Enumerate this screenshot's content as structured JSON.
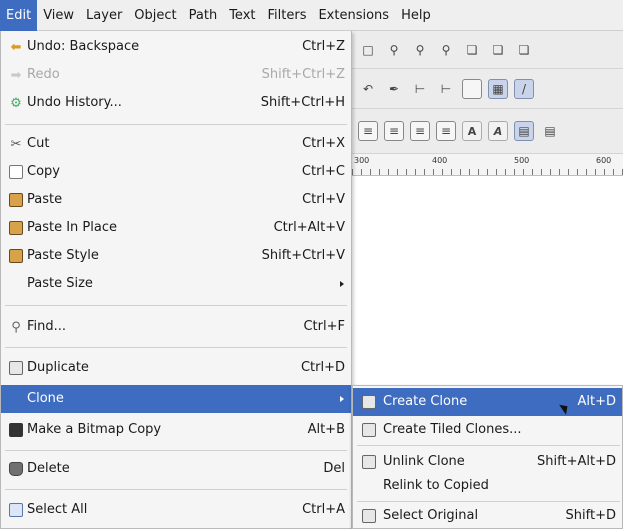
{
  "menubar": {
    "items": [
      "Edit",
      "View",
      "Layer",
      "Object",
      "Path",
      "Text",
      "Filters",
      "Extensions",
      "Help"
    ]
  },
  "edit_menu": {
    "items": [
      {
        "label": "Undo: Backspace",
        "shortcut": "Ctrl+Z",
        "icon": "undo-icon",
        "disabled": false
      },
      {
        "label": "Redo",
        "shortcut": "Shift+Ctrl+Z",
        "icon": "redo-icon",
        "disabled": true
      },
      {
        "label": "Undo History...",
        "shortcut": "Shift+Ctrl+H",
        "icon": "undo-history-icon",
        "disabled": false
      },
      {
        "label": "Cut",
        "shortcut": "Ctrl+X",
        "icon": "cut-icon",
        "disabled": false
      },
      {
        "label": "Copy",
        "shortcut": "Ctrl+C",
        "icon": "copy-icon",
        "disabled": false
      },
      {
        "label": "Paste",
        "shortcut": "Ctrl+V",
        "icon": "paste-icon",
        "disabled": false
      },
      {
        "label": "Paste In Place",
        "shortcut": "Ctrl+Alt+V",
        "icon": "paste-in-place-icon",
        "disabled": false
      },
      {
        "label": "Paste Style",
        "shortcut": "Shift+Ctrl+V",
        "icon": "paste-style-icon",
        "disabled": false
      },
      {
        "label": "Paste Size",
        "shortcut": "",
        "icon": "",
        "disabled": false
      },
      {
        "label": "Find...",
        "shortcut": "Ctrl+F",
        "icon": "find-icon",
        "disabled": false
      },
      {
        "label": "Duplicate",
        "shortcut": "Ctrl+D",
        "icon": "duplicate-icon",
        "disabled": false
      },
      {
        "label": "Clone",
        "shortcut": "",
        "icon": "",
        "disabled": false
      },
      {
        "label": "Make a Bitmap Copy",
        "shortcut": "Alt+B",
        "icon": "bitmap-copy-icon",
        "disabled": false
      },
      {
        "label": "Delete",
        "shortcut": "Del",
        "icon": "delete-icon",
        "disabled": false
      },
      {
        "label": "Select All",
        "shortcut": "Ctrl+A",
        "icon": "select-all-icon",
        "disabled": false
      }
    ]
  },
  "clone_submenu": {
    "items": [
      {
        "label": "Create Clone",
        "shortcut": "Alt+D",
        "icon": "create-clone-icon"
      },
      {
        "label": "Create Tiled Clones...",
        "shortcut": "",
        "icon": "tiled-clones-icon"
      },
      {
        "label": "Unlink Clone",
        "shortcut": "Shift+Alt+D",
        "icon": "unlink-clone-icon"
      },
      {
        "label": "Relink to Copied",
        "shortcut": "",
        "icon": ""
      },
      {
        "label": "Select Original",
        "shortcut": "Shift+D",
        "icon": "select-original-icon"
      }
    ]
  },
  "ruler": {
    "labels": [
      "300",
      "400",
      "500",
      "600"
    ]
  },
  "colors": {
    "highlight": "#3d6cc0",
    "menu_bg": "#f5f5f5",
    "disabled_text": "#a8a8a8"
  }
}
